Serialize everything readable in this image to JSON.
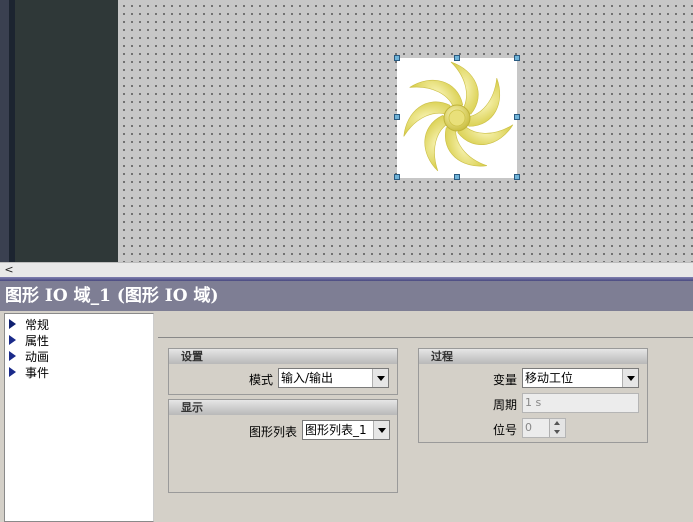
{
  "title": "图形 IO 域_1 (图形 IO 域)",
  "nav": {
    "items": [
      {
        "label": "常规"
      },
      {
        "label": "属性"
      },
      {
        "label": "动画"
      },
      {
        "label": "事件"
      }
    ]
  },
  "settings": {
    "header": "设置",
    "mode_label": "模式",
    "mode_value": "输入/输出"
  },
  "display": {
    "header": "显示",
    "graphic_list_label": "图形列表",
    "graphic_list_value": "图形列表_1"
  },
  "process": {
    "header": "过程",
    "variable_label": "变量",
    "variable_value": "移动工位",
    "cycle_label": "周期",
    "cycle_value": "1 s",
    "bit_label": "位号",
    "bit_value": "0"
  },
  "scrollbar": {
    "left_arrow": "<"
  },
  "colors": {
    "fan_blade": "#e8e06a",
    "title_bar": "#7e7e94",
    "nav_arrow": "#1a2a8a"
  }
}
